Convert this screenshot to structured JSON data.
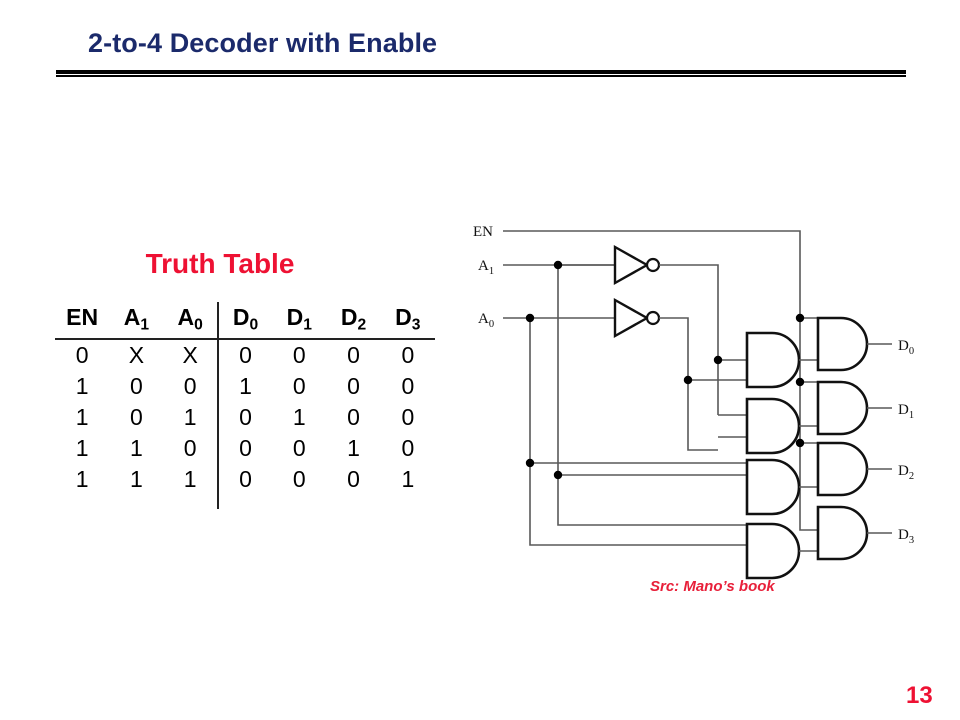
{
  "slide": {
    "title": "2-to-4 Decoder with Enable",
    "title_color": "#1b2a6b",
    "page_number": "13",
    "accent_red": "#ee1133",
    "background": "#ffffff"
  },
  "truth_table": {
    "caption": "Truth Table",
    "caption_color": "#ee1133",
    "headers": [
      "EN",
      "A1",
      "A0",
      "D0",
      "D1",
      "D2",
      "D3"
    ],
    "header_display": [
      {
        "base": "EN",
        "sub": ""
      },
      {
        "base": "A",
        "sub": "1"
      },
      {
        "base": "A",
        "sub": "0"
      },
      {
        "base": "D",
        "sub": "0"
      },
      {
        "base": "D",
        "sub": "1"
      },
      {
        "base": "D",
        "sub": "2"
      },
      {
        "base": "D",
        "sub": "3"
      }
    ],
    "divider_after_column": 3,
    "rows": [
      [
        "0",
        "X",
        "X",
        "0",
        "0",
        "0",
        "0"
      ],
      [
        "1",
        "0",
        "0",
        "1",
        "0",
        "0",
        "0"
      ],
      [
        "1",
        "0",
        "1",
        "0",
        "1",
        "0",
        "0"
      ],
      [
        "1",
        "1",
        "0",
        "0",
        "0",
        "1",
        "0"
      ],
      [
        "1",
        "1",
        "1",
        "0",
        "0",
        "0",
        "1"
      ]
    ]
  },
  "circuit": {
    "input_labels": [
      {
        "base": "EN",
        "sub": ""
      },
      {
        "base": "A",
        "sub": "1"
      },
      {
        "base": "A",
        "sub": "0"
      }
    ],
    "output_labels": [
      {
        "base": "D",
        "sub": "0"
      },
      {
        "base": "D",
        "sub": "1"
      },
      {
        "base": "D",
        "sub": "2"
      },
      {
        "base": "D",
        "sub": "3"
      }
    ],
    "gates": {
      "inverters": 2,
      "and_gates_stage1": 4,
      "and_gates_stage2": 4
    },
    "wire_color": "#595959",
    "gate_color": "#111111"
  },
  "source": {
    "credit": "Src: Mano’s book",
    "color": "#e8203a"
  }
}
